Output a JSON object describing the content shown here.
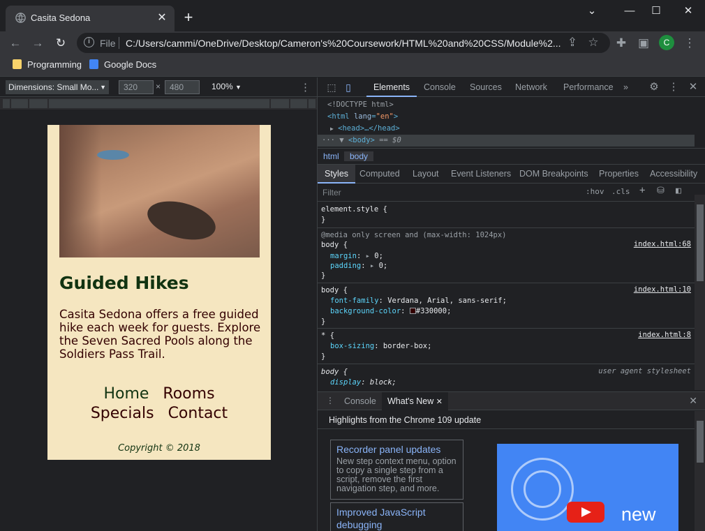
{
  "browser": {
    "tab_title": "Casita Sedona",
    "tab_close": "✕",
    "new_tab": "+",
    "scheme_label": "File",
    "url": "C:/Users/cammi/OneDrive/Desktop/Cameron's%20Coursework/HTML%20and%20CSS/Module%2...",
    "profile_initial": "C",
    "bookmarks": [
      "Programming",
      "Google Docs"
    ]
  },
  "device_toolbar": {
    "dimensions": "Dimensions: Small Mo...",
    "width": "320",
    "times": "×",
    "height": "480",
    "zoom": "100%"
  },
  "page": {
    "title": "Guided Hikes",
    "text": "Casita Sedona offers a free guided hike each week for guests. Explore the Seven Sacred Pools along the Soldiers Pass Trail.",
    "nav": [
      "Home",
      "Rooms",
      "Specials",
      "Contact"
    ],
    "copyright": "Copyright © 2018"
  },
  "devtools": {
    "tabs": [
      "Elements",
      "Console",
      "Sources",
      "Network",
      "Performance"
    ],
    "dom": {
      "doctype": "<!DOCTYPE html>",
      "html_open": "<html lang=\"en\">",
      "head": "<head>…</head>",
      "body": "<body>",
      "body_marker": "== $0"
    },
    "breadcrumbs": [
      "html",
      "body"
    ],
    "style_tabs": [
      "Styles",
      "Computed",
      "Layout",
      "Event Listeners",
      "DOM Breakpoints",
      "Properties",
      "Accessibility"
    ],
    "filter_placeholder": "Filter",
    "hov": ":hov",
    "cls": ".cls",
    "rules": {
      "element_style": "element.style {",
      "close": "}",
      "media": "@media only screen and (max-width: 1024px)",
      "body_sel": "body {",
      "margin": "margin",
      "margin_val": "0;",
      "padding": "padding",
      "padding_val": "0;",
      "src68": "index.html:68",
      "font_family": "font-family",
      "font_family_val": "Verdana, Arial, sans-serif;",
      "bg_color": "background-color",
      "bg_color_val": "#330000;",
      "src10": "index.html:10",
      "star_sel": "* {",
      "box_sizing": "box-sizing",
      "box_sizing_val": "border-box;",
      "src8": "index.html:8",
      "ua_sel": "body {",
      "ua_label": "user agent stylesheet",
      "display": "display",
      "display_val": "block;"
    },
    "swatch_color": "#330000",
    "drawer_tabs": [
      "Console",
      "What's New"
    ],
    "highlights": "Highlights from the Chrome 109 update",
    "cards": [
      {
        "title": "Recorder panel updates",
        "desc": "New step context menu, option to copy a single step from a script, remove the first navigation step, and more."
      },
      {
        "title": "Improved JavaScript debugging",
        "desc": ""
      }
    ],
    "promo_text": "new"
  }
}
